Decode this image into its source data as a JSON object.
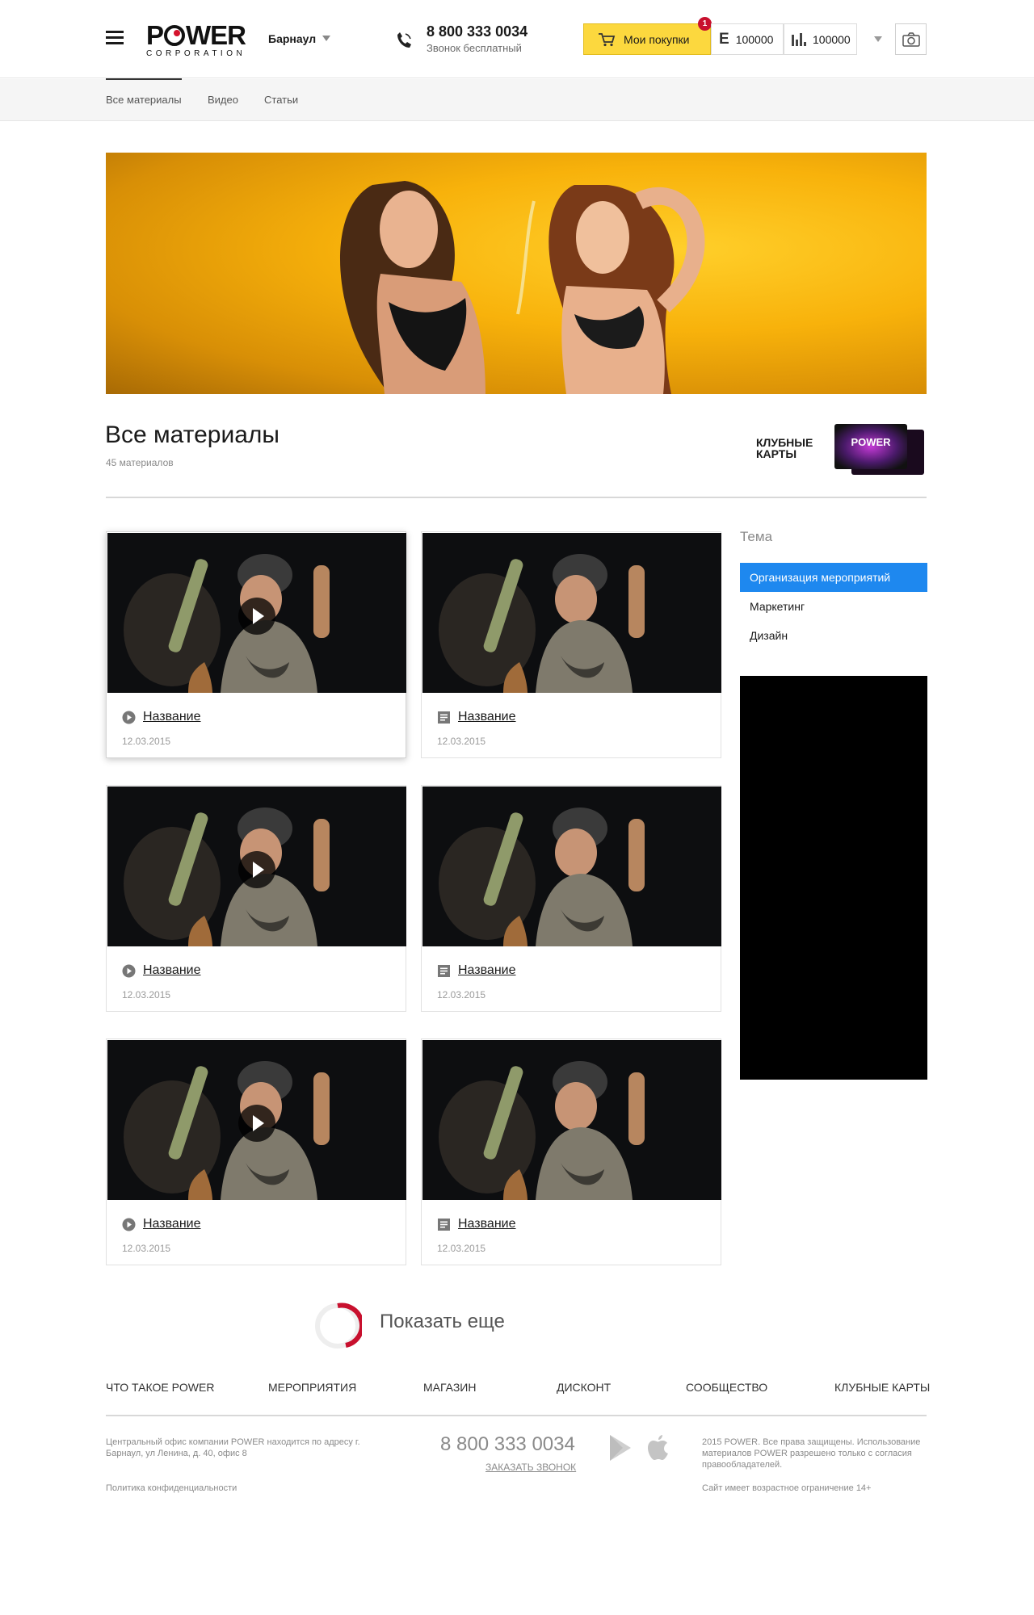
{
  "header": {
    "logo_word_left": "P",
    "logo_word_right": "WER",
    "logo_sub": "CORPORATION",
    "city": "Барнаул",
    "phone": "8 800 333 0034",
    "phone_note": "Звонок бесплатный",
    "purchases_label": "Мои покупки",
    "purchases_badge": "1",
    "counter1_icon": "E",
    "counter1_value": "100000",
    "counter2_value": "100000"
  },
  "subnav": {
    "tabs": [
      {
        "label": "Все материалы",
        "active": true
      },
      {
        "label": "Видео",
        "active": false
      },
      {
        "label": "Статьи",
        "active": false
      }
    ]
  },
  "section": {
    "title": "Все материалы",
    "count": "45 материалов",
    "club_label": "КЛУБНЫЕ КАРТЫ",
    "club_card_logo": "POWER"
  },
  "cards": [
    {
      "type": "video",
      "title": "Название",
      "date": "12.03.2015",
      "icon": "play-circle-icon"
    },
    {
      "type": "article",
      "title": "Название",
      "date": "12.03.2015",
      "icon": "article-icon"
    },
    {
      "type": "video",
      "title": "Название",
      "date": "12.03.2015",
      "icon": "play-circle-icon"
    },
    {
      "type": "article",
      "title": "Название",
      "date": "12.03.2015",
      "icon": "article-icon"
    },
    {
      "type": "video",
      "title": "Название",
      "date": "12.03.2015",
      "icon": "play-circle-icon"
    },
    {
      "type": "article",
      "title": "Название",
      "date": "12.03.2015",
      "icon": "article-icon"
    }
  ],
  "sidebar": {
    "heading": "Тема",
    "items": [
      {
        "label": "Организация мероприятий",
        "active": true
      },
      {
        "label": "Маркетинг",
        "active": false
      },
      {
        "label": "Дизайн",
        "active": false
      }
    ]
  },
  "show_more": {
    "label": "Показать еще"
  },
  "footer": {
    "nav": [
      "ЧТО ТАКОЕ POWER",
      "МЕРОПРИЯТИЯ",
      "МАГАЗИН",
      "ДИСКОНТ",
      "СООБЩЕСТВО",
      "КЛУБНЫЕ КАРТЫ"
    ],
    "address": "Центральный офис компании POWER находится по адресу г. Барнаул, ул Ленина, д. 40, офис 8",
    "phone": "8 800 333 0034",
    "callback": "ЗАКАЗАТЬ ЗВОНОК",
    "copyright": "2015 POWER. Все права защищены. Использование материалов POWER разрешено только с согласия правообладателей.",
    "policy": "Политика конфиденциальности",
    "age": "Сайт имеет возрастное ограничение 14+"
  },
  "colors": {
    "accent_red": "#d4132c",
    "purchases_yellow": "#fcd83e",
    "sidebar_active_blue": "#1e88ef",
    "banner_orange": "#f8b20b"
  }
}
